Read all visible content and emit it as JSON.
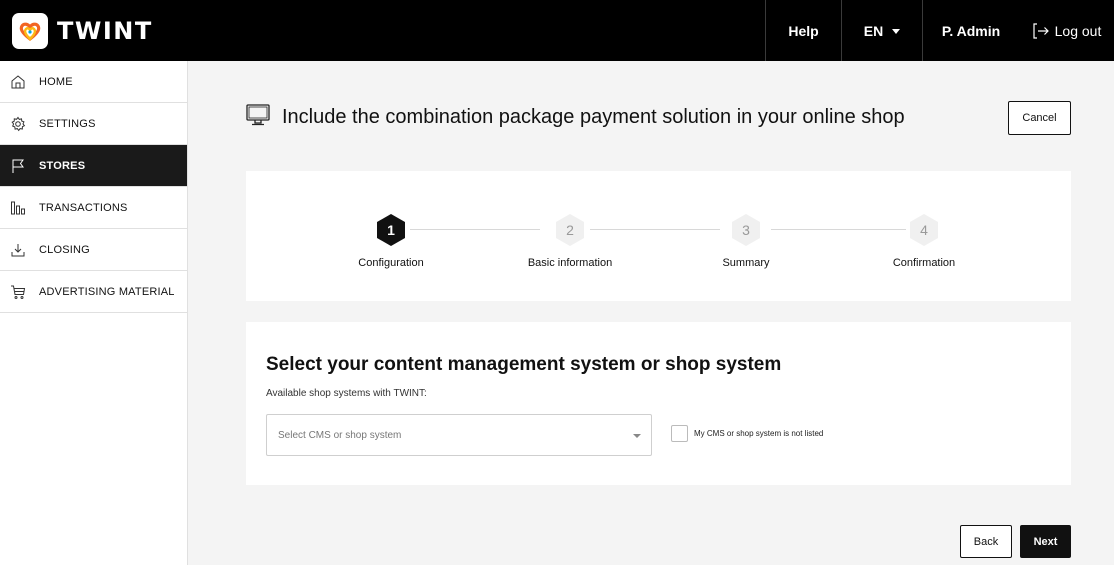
{
  "brand": {
    "name": "TWINT"
  },
  "topnav": {
    "help": "Help",
    "language": "EN",
    "user": "P. Admin",
    "logout": "Log out"
  },
  "sidebar": {
    "items": [
      {
        "label": "HOME",
        "icon": "home-icon",
        "active": false
      },
      {
        "label": "SETTINGS",
        "icon": "gear-icon",
        "active": false
      },
      {
        "label": "STORES",
        "icon": "flag-icon",
        "active": true
      },
      {
        "label": "TRANSACTIONS",
        "icon": "bar-chart-icon",
        "active": false
      },
      {
        "label": "CLOSING",
        "icon": "download-icon",
        "active": false
      },
      {
        "label": "ADVERTISING MATERIAL",
        "icon": "cart-icon",
        "active": false
      }
    ]
  },
  "page": {
    "title": "Include the combination package payment solution in your online shop",
    "title_icon": "monitor-icon",
    "cancel": "Cancel"
  },
  "stepper": {
    "steps": [
      {
        "number": "1",
        "label": "Configuration",
        "active": true
      },
      {
        "number": "2",
        "label": "Basic information",
        "active": false
      },
      {
        "number": "3",
        "label": "Summary",
        "active": false
      },
      {
        "number": "4",
        "label": "Confirmation",
        "active": false
      }
    ]
  },
  "shop_select": {
    "heading": "Select your content management system or shop system",
    "subtitle": "Available shop systems with TWINT:",
    "placeholder": "Select CMS or shop system",
    "checkbox_label": "My CMS or shop system is not listed",
    "checkbox_checked": false
  },
  "footer": {
    "back": "Back",
    "next": "Next"
  },
  "colors": {
    "dark": "#111111",
    "background": "#f4f4f4",
    "step_inactive": "#f0f0f0"
  }
}
